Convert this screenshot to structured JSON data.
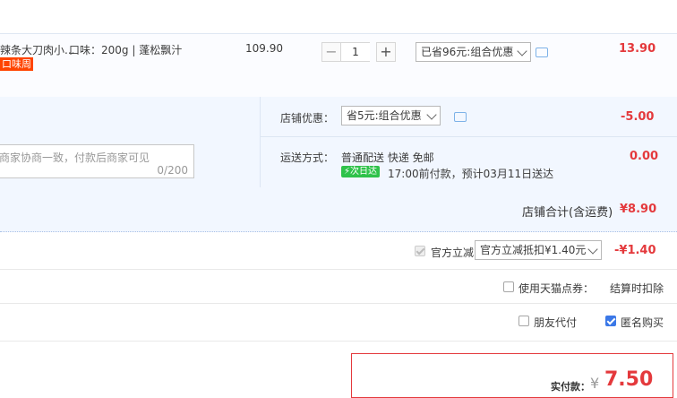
{
  "item": {
    "title": "辣条大刀肉小...",
    "spec": "口味：200g | 蓬松飘汁",
    "tag": "口味周",
    "price": "109.90",
    "qty_minus": "−",
    "quantity": "1",
    "qty_plus": "+",
    "promo_select": "已省96元:组合优惠",
    "subtotal": "13.90"
  },
  "shop": {
    "discount_label": "店铺优惠：",
    "discount_select": "省5元:组合优惠",
    "discount_value": "-5.00",
    "memo_placeholder": "商家协商一致，付款后商家可见",
    "memo_count": "0/200",
    "shipping_label": "运送方式：",
    "shipping_method": "普通配送 快递 免邮",
    "shipping_badge": "次日达",
    "shipping_note": "17:00前付款，预计03月11日送达",
    "shipping_value": "0.00",
    "total_label": "店铺合计(含运费)",
    "total_value": "¥8.90"
  },
  "official": {
    "label": "官方立减",
    "select": "官方立减抵扣¥1.40元",
    "value": "-¥1.40"
  },
  "points": {
    "label": "使用天猫点券：",
    "note": "结算时扣除"
  },
  "options": {
    "friend_pay": "朋友代付",
    "anonymous": "匿名购买"
  },
  "payment": {
    "label": "实付款：",
    "currency": "¥",
    "amount": "7.50"
  }
}
